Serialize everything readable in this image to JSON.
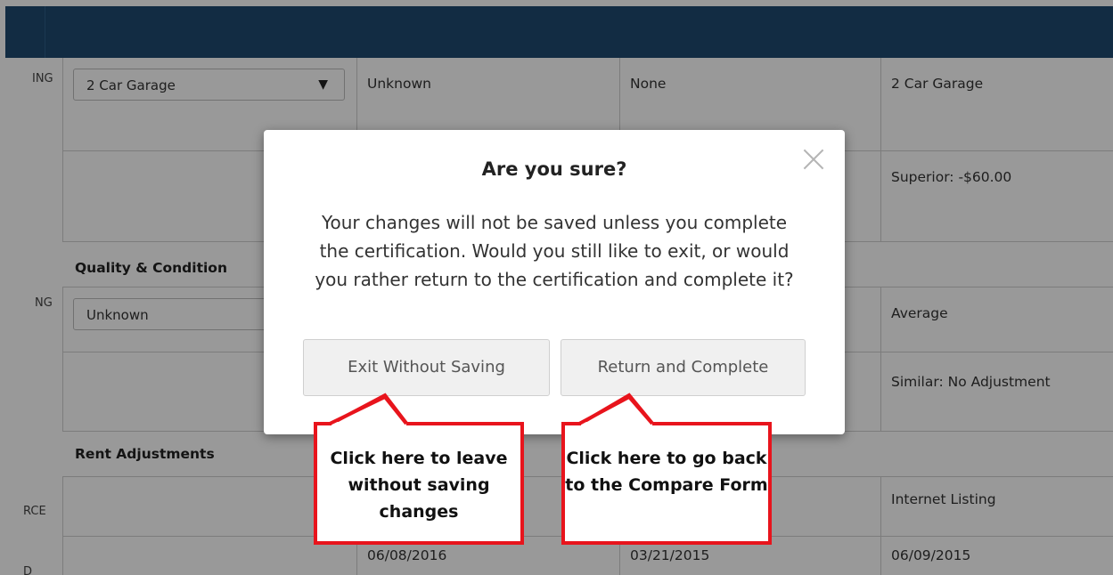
{
  "leftcol": {
    "labels": [
      "ING",
      "NG",
      "RCE",
      "D"
    ]
  },
  "rows": {
    "row1": {
      "select_value": "2 Car Garage",
      "col2": "Unknown",
      "col3": "None",
      "col4": "2 Car Garage"
    },
    "row2": {
      "col4": "Superior: -$60.00"
    },
    "section1": {
      "title": "Quality & Condition"
    },
    "row3": {
      "select_value": "Unknown",
      "col4": "Average"
    },
    "row4": {
      "col4": "Similar: No Adjustment"
    },
    "section2": {
      "title": "Rent Adjustments"
    },
    "row5": {
      "col4": "Internet Listing"
    },
    "row6": {
      "col2": "06/08/2016",
      "col3": "03/21/2015",
      "col4": "06/09/2015"
    }
  },
  "modal": {
    "title": "Are you sure?",
    "body": "Your changes will not be saved unless you complete the certification. Would you still like to exit, or would you rather return to the certification and complete it?",
    "exit_label": "Exit Without Saving",
    "return_label": "Return and Complete",
    "close_icon": "close-icon"
  },
  "callouts": {
    "exit": "Click here to leave without saving changes",
    "return": "Click here to go back to the Compare Form"
  },
  "colors": {
    "topbar": "#1f4a70",
    "callout_border": "#e8141c"
  }
}
